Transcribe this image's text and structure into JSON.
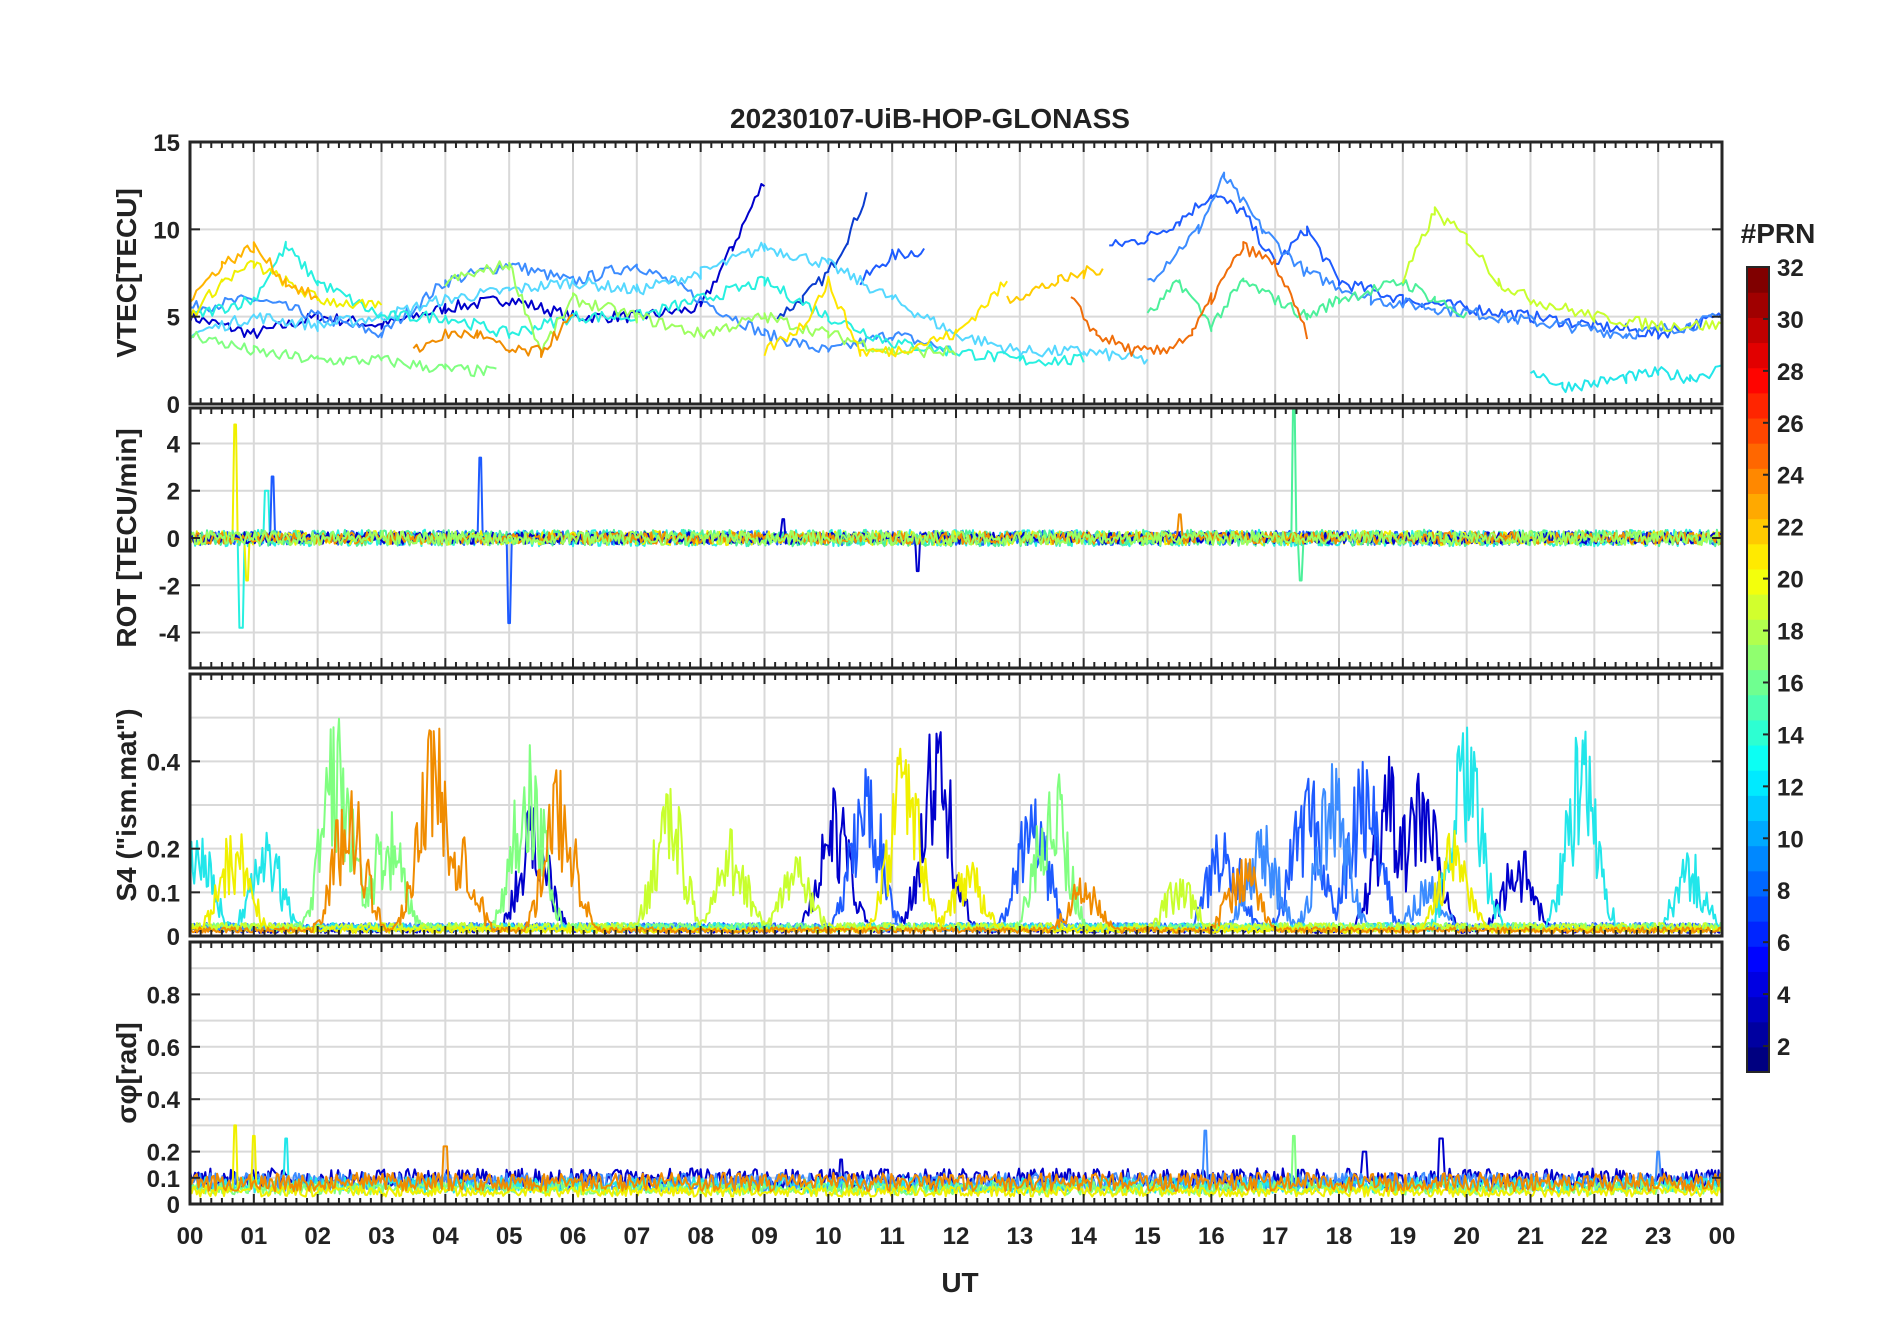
{
  "chart_data": {
    "title": "20230107-UiB-HOP-GLONASS",
    "type": "line",
    "xlabel": "UT",
    "x_ticklabels": [
      "00",
      "01",
      "02",
      "03",
      "04",
      "05",
      "06",
      "07",
      "08",
      "09",
      "10",
      "11",
      "12",
      "13",
      "14",
      "15",
      "16",
      "17",
      "18",
      "19",
      "20",
      "21",
      "22",
      "23",
      "00"
    ],
    "xlim": [
      0,
      24
    ],
    "grid": true,
    "colorbar": {
      "label": "#PRN",
      "ticks": [
        "2",
        "4",
        "6",
        "8",
        "10",
        "12",
        "14",
        "16",
        "18",
        "20",
        "22",
        "24",
        "26",
        "28",
        "30",
        "32"
      ],
      "range": [
        1,
        32
      ],
      "colormap": "jet"
    },
    "panels": [
      {
        "id": "vtec",
        "ylabel": "VTEC[TECU]",
        "ylim": [
          0,
          15
        ],
        "yticks": [
          "0",
          "5",
          "10",
          "15"
        ],
        "series": [
          {
            "color": "#0000cc",
            "x": [
              0,
              1,
              2,
              3,
              4,
              5,
              6,
              7,
              8,
              8.5,
              9.0
            ],
            "y": [
              5,
              4,
              5,
              4.5,
              5.5,
              6,
              5,
              5,
              5.5,
              9,
              12.8
            ]
          },
          {
            "color": "#0a3ccf",
            "x": [
              9.2,
              9.6,
              10,
              10.3,
              10.6
            ],
            "y": [
              5,
              6,
              7.5,
              9.5,
              12
            ]
          },
          {
            "color": "#1e5bff",
            "x": [
              10.5,
              11,
              11.5
            ],
            "y": [
              7,
              8.5,
              8.8
            ]
          },
          {
            "color": "#3c8cff",
            "x": [
              0,
              1,
              2,
              3,
              4,
              5,
              6,
              7,
              8,
              9,
              10,
              11,
              12
            ],
            "y": [
              5.5,
              6,
              5,
              4,
              7,
              8,
              7,
              8,
              6,
              4,
              3,
              4,
              3
            ]
          },
          {
            "color": "#1e5bff",
            "x": [
              14.4,
              15,
              15.5,
              16,
              16.5,
              17,
              17.5,
              18,
              19,
              20,
              21,
              22,
              23,
              24
            ],
            "y": [
              9,
              9.5,
              10.5,
              12,
              11,
              8,
              10,
              7,
              6,
              5.5,
              5,
              4.5,
              4,
              5
            ]
          },
          {
            "color": "#3c8cff",
            "x": [
              15,
              15.8,
              16.2,
              16.8,
              17.5,
              18.5,
              19.5,
              20.5,
              21.5,
              22.5,
              23.5,
              24
            ],
            "y": [
              7,
              10,
              13,
              10,
              7.5,
              6,
              5.5,
              5,
              4.5,
              4,
              4.5,
              5
            ]
          },
          {
            "color": "#55d8ff",
            "x": [
              0,
              1,
              2,
              3,
              4,
              5,
              6,
              7,
              8,
              9,
              10,
              11,
              12,
              13,
              14,
              15
            ],
            "y": [
              4,
              5,
              4.5,
              5,
              6,
              6.5,
              7,
              6.5,
              7.5,
              9,
              8,
              6,
              4,
              3,
              3,
              2.5
            ]
          },
          {
            "color": "#27f0e0",
            "x": [
              0,
              1,
              1.5,
              2,
              3,
              4,
              5,
              6,
              7,
              8,
              9,
              10,
              11,
              12,
              13,
              14
            ],
            "y": [
              5,
              6,
              9,
              7,
              5,
              5,
              4,
              5,
              5,
              6,
              7,
              5,
              3.5,
              3,
              2.5,
              2.5
            ]
          },
          {
            "color": "#22e6ea",
            "x": [
              21,
              21.5,
              22,
              22.5,
              23,
              23.5,
              24
            ],
            "y": [
              2,
              1,
              1.2,
              1.5,
              1.8,
              1.5,
              2
            ]
          },
          {
            "color": "#80ff80",
            "x": [
              0,
              1,
              2,
              3,
              4,
              4.8
            ],
            "y": [
              4,
              3,
              2.5,
              2.5,
              2,
              1.8
            ]
          },
          {
            "color": "#9dff5f",
            "x": [
              4,
              5,
              5.5,
              6,
              7,
              8,
              9,
              10,
              11,
              12
            ],
            "y": [
              7,
              8,
              3,
              6,
              5,
              4,
              5,
              4,
              3,
              3
            ]
          },
          {
            "color": "#4cf09a",
            "x": [
              15,
              15.5,
              16,
              16.5,
              17,
              17.5,
              18,
              19,
              19.5,
              20
            ],
            "y": [
              5,
              7,
              4.5,
              7,
              6,
              5,
              6,
              7,
              6,
              5
            ]
          },
          {
            "color": "#c8ff2e",
            "x": [
              19,
              19.5,
              20,
              20.5,
              21,
              22,
              23,
              24
            ],
            "y": [
              7,
              11,
              9.5,
              7,
              6,
              5,
              4.5,
              4.5
            ]
          },
          {
            "color": "#f0f000",
            "x": [
              0,
              0.5,
              1,
              1.5,
              2,
              3
            ],
            "y": [
              5,
              7,
              8,
              7,
              6,
              5.5
            ]
          },
          {
            "color": "#ffe600",
            "x": [
              9,
              9.6,
              10,
              10.5,
              11,
              12,
              12.8
            ],
            "y": [
              3,
              4.5,
              7,
              3,
              3,
              4,
              7
            ]
          },
          {
            "color": "#ffcc00",
            "x": [
              12.8,
              13.2,
              13.6,
              14,
              14.3
            ],
            "y": [
              6,
              6.5,
              7,
              7.5,
              7.8
            ]
          },
          {
            "color": "#ffb400",
            "x": [
              0,
              0.5,
              1,
              1.5,
              2
            ],
            "y": [
              6,
              8,
              9,
              7,
              6
            ]
          },
          {
            "color": "#f08c00",
            "x": [
              3.5,
              4,
              4.5,
              5,
              5.5,
              6
            ],
            "y": [
              3,
              4,
              4,
              3,
              3,
              5
            ]
          },
          {
            "color": "#f06e0a",
            "x": [
              13.8,
              14.2,
              14.8,
              15.2,
              15.7,
              16,
              16.5,
              17,
              17.5
            ],
            "y": [
              6,
              4,
              3,
              3,
              4,
              6,
              9,
              8,
              4
            ]
          }
        ]
      },
      {
        "id": "rot",
        "ylabel": "ROT [TECU/min]",
        "ylim": [
          -5.5,
          5.5
        ],
        "yticks": [
          "-4",
          "-2",
          "0",
          "2",
          "4"
        ],
        "series": [
          {
            "color": "#27f0e0",
            "spikes": [
              [
                0.8,
                -3.8
              ],
              [
                1.2,
                2.0
              ]
            ],
            "base_amp": 0.35
          },
          {
            "color": "#1e5bff",
            "spikes": [
              [
                4.55,
                3.4
              ],
              [
                5.0,
                -3.6
              ],
              [
                1.3,
                2.6
              ]
            ],
            "base_amp": 0.3
          },
          {
            "color": "#f0f000",
            "spikes": [
              [
                0.7,
                4.8
              ],
              [
                0.9,
                -1.8
              ]
            ],
            "base_amp": 0.3
          },
          {
            "color": "#4cf09a",
            "spikes": [
              [
                17.3,
                5.5
              ],
              [
                17.4,
                -1.8
              ]
            ],
            "base_amp": 0.35
          },
          {
            "color": "#0000cc",
            "spikes": [
              [
                11.4,
                -1.4
              ],
              [
                9.3,
                0.8
              ]
            ],
            "base_amp": 0.25
          },
          {
            "color": "#f08c00",
            "spikes": [
              [
                15.5,
                1.0
              ]
            ],
            "base_amp": 0.25
          },
          {
            "color": "#9dff5f",
            "spikes": [],
            "base_amp": 0.3
          }
        ]
      },
      {
        "id": "s4",
        "ylabel": "S4 (\"ism.mat\")",
        "ylim": [
          0,
          0.6
        ],
        "yticks": [
          "0",
          "0.1",
          "0.2",
          "0.4"
        ],
        "series": [
          {
            "color": "#0000cc",
            "bursts": [
              [
                10.1,
                0.35
              ],
              [
                11.7,
                0.52
              ],
              [
                18.8,
                0.42
              ],
              [
                19.3,
                0.41
              ],
              [
                20.8,
                0.22
              ],
              [
                5.4,
                0.32
              ]
            ],
            "base": 0.02
          },
          {
            "color": "#1e5bff",
            "bursts": [
              [
                10.6,
                0.42
              ],
              [
                13.2,
                0.35
              ],
              [
                16.2,
                0.3
              ],
              [
                17.5,
                0.4
              ],
              [
                18.4,
                0.42
              ]
            ],
            "base": 0.03
          },
          {
            "color": "#3c8cff",
            "bursts": [
              [
                17.9,
                0.4
              ],
              [
                16.8,
                0.28
              ],
              [
                19.4,
                0.15
              ]
            ],
            "base": 0.03
          },
          {
            "color": "#22e6ea",
            "bursts": [
              [
                0.1,
                0.28
              ],
              [
                1.2,
                0.25
              ],
              [
                20.0,
                0.5
              ],
              [
                21.8,
                0.49
              ],
              [
                23.5,
                0.2
              ]
            ],
            "base": 0.03
          },
          {
            "color": "#80ff80",
            "bursts": [
              [
                2.3,
                0.52
              ],
              [
                3.1,
                0.3
              ],
              [
                5.3,
                0.48
              ],
              [
                13.5,
                0.42
              ]
            ],
            "base": 0.03
          },
          {
            "color": "#c8ff2e",
            "bursts": [
              [
                7.5,
                0.37
              ],
              [
                8.5,
                0.25
              ],
              [
                9.5,
                0.2
              ],
              [
                15.5,
                0.15
              ]
            ],
            "base": 0.03
          },
          {
            "color": "#f0f000",
            "bursts": [
              [
                11.2,
                0.47
              ],
              [
                12.2,
                0.2
              ],
              [
                19.8,
                0.25
              ],
              [
                0.7,
                0.26
              ]
            ],
            "base": 0.02
          },
          {
            "color": "#f08c00",
            "bursts": [
              [
                2.5,
                0.38
              ],
              [
                3.8,
                0.53
              ],
              [
                4.2,
                0.3
              ],
              [
                5.8,
                0.4
              ],
              [
                14.0,
                0.15
              ],
              [
                16.5,
                0.2
              ]
            ],
            "base": 0.02
          }
        ]
      },
      {
        "id": "sigma_phi",
        "ylabel": "σφ[rad]",
        "ylim": [
          0,
          1.0
        ],
        "yticks": [
          "0",
          "0.1",
          "0.2",
          "0.4",
          "0.6",
          "0.8"
        ],
        "series": [
          {
            "color": "#0000cc",
            "spikes": [
              [
                19.6,
                0.25
              ],
              [
                18.4,
                0.2
              ],
              [
                10.2,
                0.17
              ]
            ],
            "base": 0.08
          },
          {
            "color": "#3c8cff",
            "spikes": [
              [
                15.9,
                0.28
              ],
              [
                23.0,
                0.2
              ]
            ],
            "base": 0.07
          },
          {
            "color": "#22e6ea",
            "spikes": [
              [
                1.5,
                0.25
              ]
            ],
            "base": 0.06
          },
          {
            "color": "#80ff80",
            "spikes": [
              [
                17.3,
                0.26
              ]
            ],
            "base": 0.05
          },
          {
            "color": "#f0f000",
            "spikes": [
              [
                0.7,
                0.3
              ],
              [
                1.0,
                0.26
              ]
            ],
            "base": 0.04
          },
          {
            "color": "#f08c00",
            "spikes": [
              [
                4.0,
                0.22
              ]
            ],
            "base": 0.07
          }
        ]
      }
    ]
  }
}
